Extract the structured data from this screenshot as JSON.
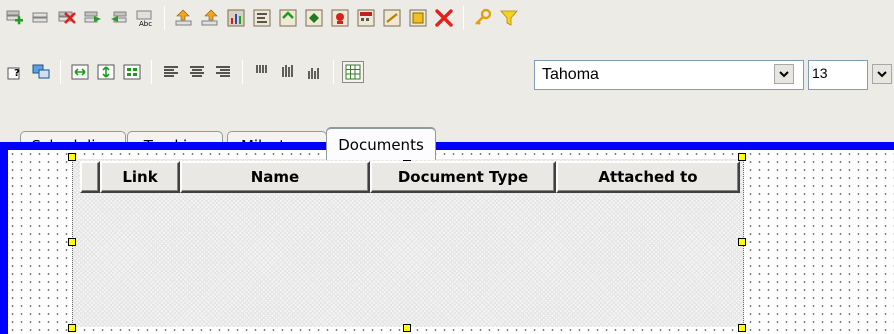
{
  "toolbar_top": {
    "buttons": [
      {
        "name": "add-row-icon"
      },
      {
        "name": "insert-row-icon"
      },
      {
        "name": "delete-row-icon"
      },
      {
        "name": "indent-icon"
      },
      {
        "name": "outdent-icon"
      },
      {
        "name": "spell-check-icon"
      },
      {
        "name": "import-icon"
      },
      {
        "name": "export-icon"
      },
      {
        "name": "chart-icon"
      },
      {
        "name": "report-icon"
      },
      {
        "name": "task-icon"
      },
      {
        "name": "milestone-icon"
      },
      {
        "name": "resource-icon"
      },
      {
        "name": "calendar-icon"
      },
      {
        "name": "note-icon"
      },
      {
        "name": "properties-icon"
      },
      {
        "name": "delete-icon"
      },
      {
        "name": "key-icon"
      },
      {
        "name": "filter-icon"
      }
    ]
  },
  "toolbar_format": {
    "font": "Tahoma",
    "size": "13"
  },
  "tabs": [
    {
      "label": "Scheduling"
    },
    {
      "label": "Tracking"
    },
    {
      "label": "Milestone"
    },
    {
      "label": "Documents",
      "active": true
    }
  ],
  "grid": {
    "columns": [
      "",
      "Link",
      "Name",
      "Document Type",
      "Attached to"
    ]
  },
  "colors": {
    "accent_blue": "#0000ff",
    "handle_yellow": "#ffff00"
  }
}
